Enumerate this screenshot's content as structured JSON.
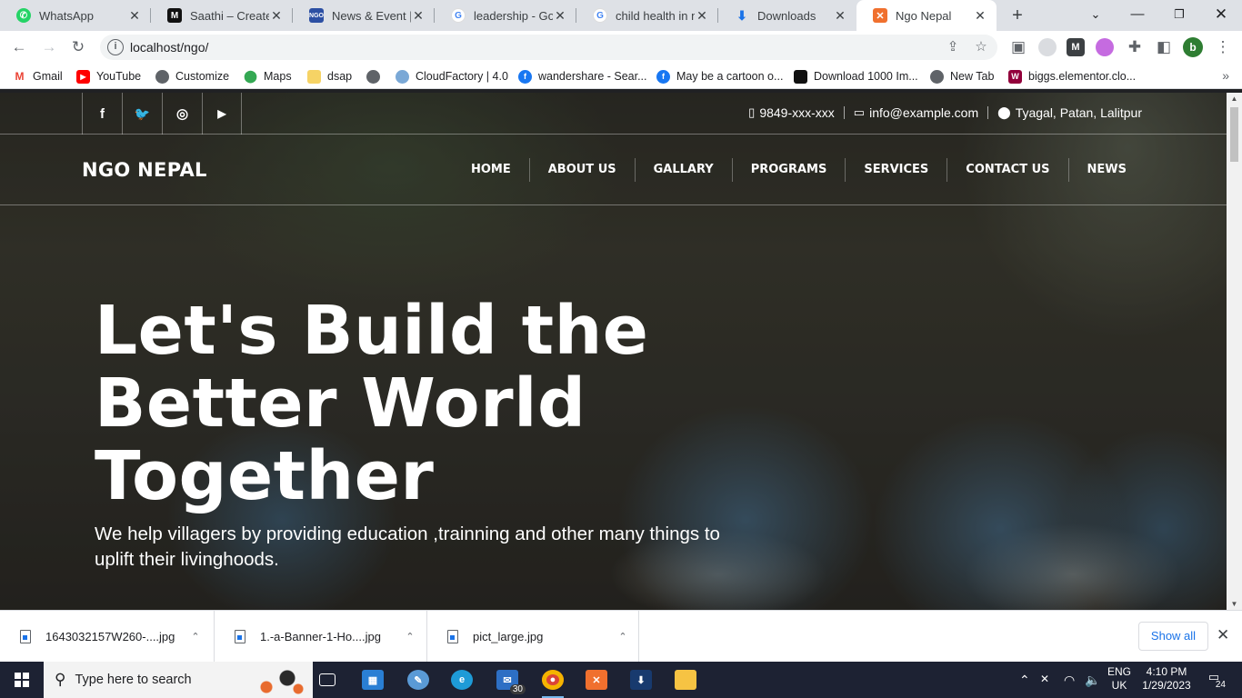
{
  "browser": {
    "tabs": [
      {
        "title": "WhatsApp",
        "favicon": "whatsapp-icon",
        "color": "#25d366"
      },
      {
        "title": "Saathi – Create v",
        "favicon": "saathi-icon",
        "color": "#111111"
      },
      {
        "title": "News & Event | N",
        "favicon": "ngo-icon",
        "color": "#2c4fa3"
      },
      {
        "title": "leadership - Goo",
        "favicon": "google-icon",
        "color": "#4285f4"
      },
      {
        "title": "child health in ne",
        "favicon": "google-icon",
        "color": "#4285f4"
      },
      {
        "title": "Downloads",
        "favicon": "download-icon",
        "color": "#1a73e8"
      },
      {
        "title": "Ngo Nepal",
        "favicon": "xampp-icon",
        "color": "#f0702e",
        "active": true
      }
    ],
    "url": "localhost/ngo/",
    "profile_initial": "b",
    "bookmarks": [
      {
        "label": "Gmail",
        "icon": "gmail-icon",
        "color": "#ea4335"
      },
      {
        "label": "YouTube",
        "icon": "youtube-icon",
        "color": "#ff0000"
      },
      {
        "label": "Customize",
        "icon": "globe-icon",
        "color": "#5f6368"
      },
      {
        "label": "Maps",
        "icon": "maps-icon",
        "color": "#34a853"
      },
      {
        "label": "dsap",
        "icon": "folder-icon",
        "color": "#f6d365"
      },
      {
        "label": "",
        "icon": "globe-icon",
        "color": "#5f6368"
      },
      {
        "label": "CloudFactory | 4.0",
        "icon": "cloudfactory-icon",
        "color": "#7aa8d6"
      },
      {
        "label": "wandershare - Sear...",
        "icon": "facebook-icon",
        "color": "#1877f2"
      },
      {
        "label": "May be a cartoon o...",
        "icon": "facebook-icon",
        "color": "#1877f2"
      },
      {
        "label": "Download 1000 Im...",
        "icon": "download-site-icon",
        "color": "#111111"
      },
      {
        "label": "New Tab",
        "icon": "globe-icon",
        "color": "#5f6368"
      },
      {
        "label": "biggs.elementor.clo...",
        "icon": "elementor-icon",
        "color": "#92003b"
      }
    ]
  },
  "site": {
    "socials": [
      "facebook-icon",
      "twitter-icon",
      "instagram-icon",
      "youtube-icon"
    ],
    "social_glyphs": [
      "f",
      "🐦",
      "◎",
      "▶"
    ],
    "phone": "9849-xxx-xxx",
    "email": "info@example.com",
    "address": "Tyagal, Patan, Lalitpur",
    "brand": "NGO NEPAL",
    "nav": [
      "HOME",
      "ABOUT US",
      "GALLARY",
      "PROGRAMS",
      "SERVICES",
      "CONTACT US",
      "NEWS"
    ],
    "hero_title": [
      "Let's Build the",
      "Better World",
      "Together"
    ],
    "hero_subtitle": "We help villagers by providing education ,trainning and other many things to uplift their livinghoods."
  },
  "downloads": {
    "files": [
      "1643032157W260-....jpg",
      "1.-a-Banner-1-Ho....jpg",
      "pict_large.jpg"
    ],
    "show_all": "Show all"
  },
  "taskbar": {
    "search_placeholder": "Type here to search",
    "mail_badge": "30",
    "language": [
      "ENG",
      "UK"
    ],
    "time": "4:10 PM",
    "date": "1/29/2023",
    "notifications": "24"
  }
}
